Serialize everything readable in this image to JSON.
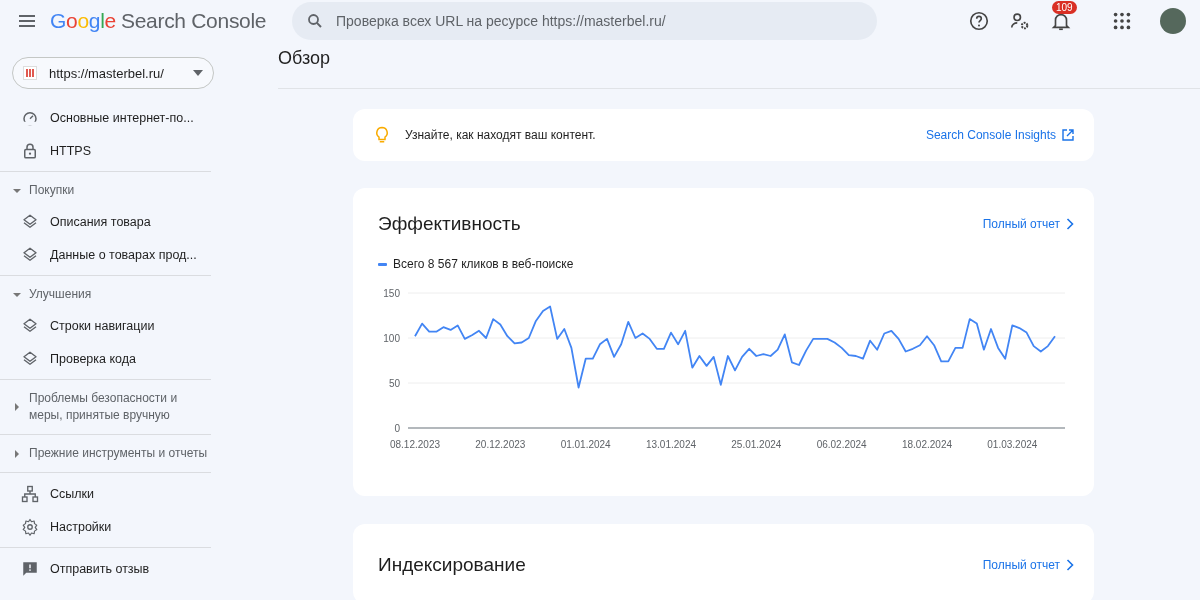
{
  "header": {
    "logo_brand": "Google",
    "logo_product": "Search Console",
    "search": {
      "placeholder": "Проверка всех URL на ресурсе https://masterbel.ru/"
    },
    "notifications_badge": "109"
  },
  "sidebar": {
    "property": "https://masterbel.ru/",
    "sections": [
      {
        "items": [
          "Основные интернет-по...",
          "HTTPS"
        ]
      },
      {
        "header": "Покупки",
        "expanded": true,
        "items": [
          "Описания товара",
          "Данные о товарах прод..."
        ]
      },
      {
        "header": "Улучшения",
        "expanded": true,
        "items": [
          "Строки навигации",
          "Проверка кода"
        ]
      },
      {
        "header": "Проблемы безопасности и меры, принятые вручную",
        "expanded": false
      },
      {
        "header": "Прежние инструменты и отчеты",
        "expanded": false
      },
      {
        "items": [
          "Ссылки",
          "Настройки"
        ]
      },
      {
        "items": [
          "Отправить отзыв"
        ]
      }
    ]
  },
  "main": {
    "title": "Обзор",
    "insights": {
      "text": "Узнайте, как находят ваш контент.",
      "link": "Search Console Insights"
    },
    "performance": {
      "title": "Эффективность",
      "link": "Полный отчет",
      "chart_data": {
        "type": "line",
        "categories": [
          "08.12.2023",
          null,
          null,
          null,
          null,
          null,
          null,
          null,
          null,
          null,
          null,
          null,
          "20.12.2023",
          null,
          null,
          null,
          null,
          null,
          null,
          null,
          null,
          null,
          null,
          null,
          "01.01.2024",
          null,
          null,
          null,
          null,
          null,
          null,
          null,
          null,
          null,
          null,
          null,
          "13.01.2024",
          null,
          null,
          null,
          null,
          null,
          null,
          null,
          null,
          null,
          null,
          null,
          "25.01.2024",
          null,
          null,
          null,
          null,
          null,
          null,
          null,
          null,
          null,
          null,
          null,
          "06.02.2024",
          null,
          null,
          null,
          null,
          null,
          null,
          null,
          null,
          null,
          null,
          null,
          "18.02.2024",
          null,
          null,
          null,
          null,
          null,
          null,
          null,
          null,
          null,
          null,
          null,
          "01.03.2024",
          null,
          null,
          null,
          null,
          null,
          null
        ],
        "series": [
          {
            "name": "Всего 8 567 кликов в веб-поиске",
            "color": "#4285f4",
            "values": [
              102,
              116,
              107,
              107,
              112,
              109,
              114,
              99,
              103,
              108,
              100,
              121,
              115,
              102,
              94,
              95,
              100,
              119,
              130,
              135,
              99,
              110,
              89,
              45,
              77,
              77,
              93,
              99,
              79,
              93,
              118,
              100,
              105,
              99,
              88,
              88,
              106,
              93,
              108,
              67,
              80,
              69,
              79,
              48,
              80,
              64,
              79,
              88,
              80,
              82,
              80,
              87,
              104,
              73,
              70,
              86,
              99,
              99,
              99,
              95,
              89,
              81,
              80,
              77,
              97,
              87,
              105,
              108,
              99,
              85,
              88,
              92,
              102,
              92,
              74,
              74,
              89,
              89,
              121,
              116,
              87,
              110,
              89,
              77,
              114,
              111,
              106,
              91,
              85,
              91,
              102
            ]
          }
        ],
        "ylim": [
          0,
          150
        ],
        "yticks": [
          0,
          50,
          100,
          150
        ]
      }
    },
    "indexing": {
      "title": "Индексирование",
      "link": "Полный отчет"
    }
  }
}
